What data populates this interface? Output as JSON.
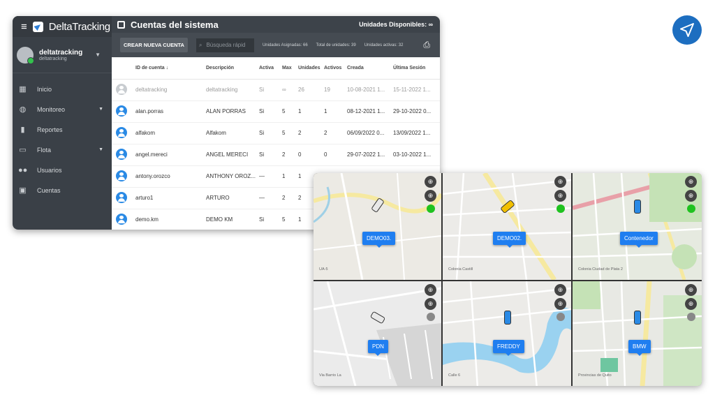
{
  "app": {
    "brand": "DeltaTracking",
    "user": {
      "name": "deltatracking",
      "sub": "deltatracking"
    }
  },
  "sidebar": {
    "items": [
      {
        "label": "Inicio",
        "icon": "dashboard-icon"
      },
      {
        "label": "Monitoreo",
        "icon": "globe-icon",
        "expandable": true
      },
      {
        "label": "Reportes",
        "icon": "bar-chart-icon"
      },
      {
        "label": "Flota",
        "icon": "car-icon",
        "expandable": true
      },
      {
        "label": "Usuarios",
        "icon": "users-icon"
      },
      {
        "label": "Cuentas",
        "icon": "account-box-icon"
      }
    ]
  },
  "header": {
    "title": "Cuentas del sistema",
    "right": "Unidades Disponibles: ∞"
  },
  "toolbar": {
    "create_label": "CREAR NUEVA CUENTA",
    "search_placeholder": "Búsqueda rápid",
    "assigned": "Unidades Asignadas: 66",
    "total": "Total de unidades: 39",
    "active": "Unidades activas: 32"
  },
  "table": {
    "columns": [
      "ID de cuenta ↓",
      "Descripción",
      "Activa",
      "Max",
      "Unidades",
      "Activos",
      "Creada",
      "Última Sesión"
    ],
    "rows": [
      [
        "deltatracking",
        "deltatracking",
        "Si",
        "∞",
        "26",
        "19",
        "10-08-2021 1...",
        "15-11-2022 1..."
      ],
      [
        "alan.porras",
        "ALAN PORRAS",
        "Si",
        "5",
        "1",
        "1",
        "08-12-2021 1...",
        "29-10-2022 0..."
      ],
      [
        "alfakom",
        "Alfakom",
        "Si",
        "5",
        "2",
        "2",
        "06/09/2022 0...",
        "13/09/2022 1..."
      ],
      [
        "angel.mereci",
        "ANGEL MERECI",
        "Si",
        "2",
        "0",
        "0",
        "29-07-2022 1...",
        "03-10-2022 1..."
      ],
      [
        "antony.orozco",
        "ANTHONY OROZ...",
        "—",
        "1",
        "1",
        "",
        "",
        ""
      ],
      [
        "arturo1",
        "ARTURO",
        "—",
        "2",
        "2",
        "",
        "",
        ""
      ],
      [
        "demo.km",
        "DEMO KM",
        "Si",
        "5",
        "1",
        "",
        "",
        ""
      ]
    ]
  },
  "maps": {
    "tiles": [
      {
        "vehicle": "DEMO03.",
        "status": "#1fc21f",
        "road": "UA-5"
      },
      {
        "vehicle": "DEMO02.",
        "status": "#1fc21f",
        "road": "Colonia Castill"
      },
      {
        "vehicle": "Contenedor",
        "status": "#1fc21f",
        "road": "Colonia Ciudad de Plata 2"
      },
      {
        "vehicle": "PDN",
        "status": "#888888",
        "road": "Via Barrio La"
      },
      {
        "vehicle": "FREDDY",
        "status": "#888888",
        "road": "Calle 6"
      },
      {
        "vehicle": "BMW",
        "status": "#888888",
        "road": "Provincias de Quito"
      }
    ]
  },
  "colors": {
    "accent": "#1f7ef0",
    "sidebar": "#3a4047"
  }
}
